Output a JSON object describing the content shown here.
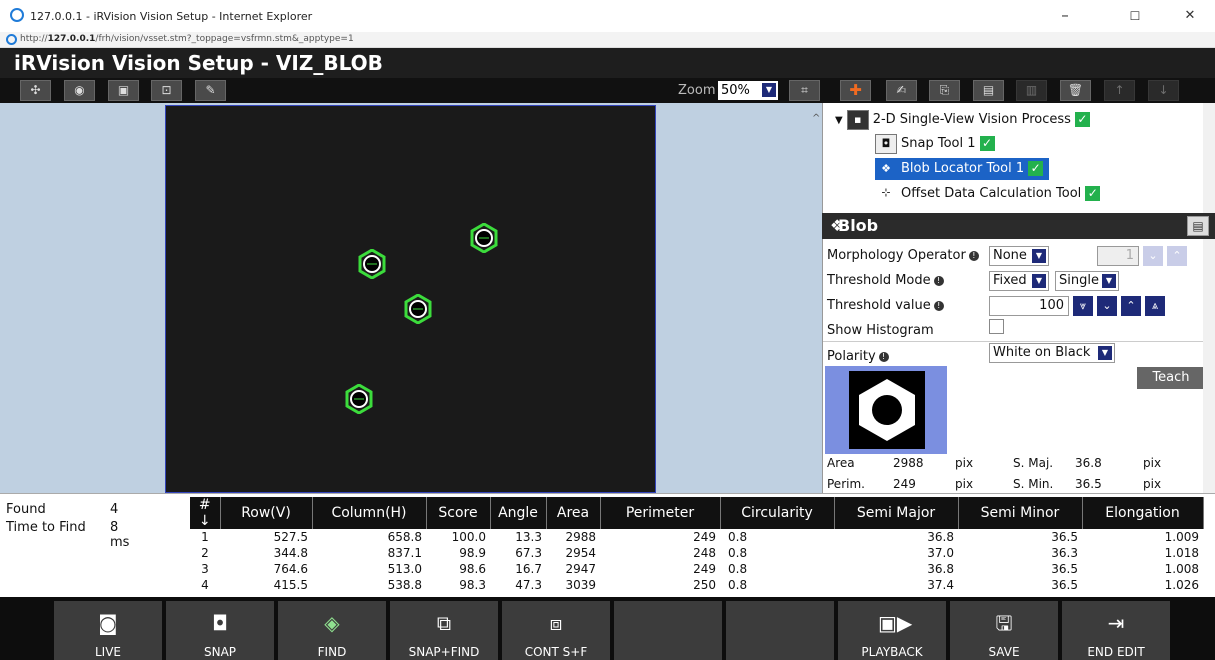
{
  "window": {
    "title": "127.0.0.1 - iRVision Vision Setup - Internet Explorer",
    "minimize": "–",
    "maximize": "☐",
    "close": "✕"
  },
  "address": {
    "prefix": "http://",
    "host": "127.0.0.1",
    "path": "/frh/vision/vsset.stm?_toppage=vsfrmn.stm&_apptype=1"
  },
  "app": {
    "title": "iRVision Vision Setup - VIZ_BLOB"
  },
  "toolbar": {
    "zoom_label": "Zoom",
    "zoom_value": "50%"
  },
  "tree": {
    "process": "2-D Single-View Vision Process",
    "items": [
      "Snap Tool 1",
      "Blob Locator Tool 1",
      "Offset Data Calculation Tool"
    ]
  },
  "panel": {
    "title": "Blob Locator Tool 1"
  },
  "props": {
    "morph_label": "Morphology Operator",
    "morph_value": "None",
    "morph_count": "1",
    "thresh_mode_label": "Threshold Mode",
    "thresh_mode_value": "Fixed",
    "thresh_mode2": "Single",
    "thresh_value_label": "Threshold value",
    "thresh_value": "100",
    "histogram_label": "Show Histogram",
    "polarity_label": "Polarity",
    "polarity_value": "White on Black",
    "teach": "Teach",
    "area_label": "Area",
    "area_value": "2988",
    "area_unit": "pix",
    "smaj_label": "S. Maj.",
    "smaj_value": "36.8",
    "smaj_unit": "pix",
    "perim_label": "Perim.",
    "perim_value": "249",
    "perim_unit": "pix",
    "smin_label": "S. Min.",
    "smin_value": "36.5",
    "smin_unit": "pix"
  },
  "summary": {
    "found_label": "Found",
    "found_value": "4",
    "time_label": "Time to Find",
    "time_value": "8 ms"
  },
  "results": {
    "headers": [
      "# ↓",
      "Row(V)",
      "Column(H)",
      "Score",
      "Angle",
      "Area",
      "Perimeter",
      "Circularity",
      "Semi Major",
      "Semi Minor",
      "Elongation"
    ],
    "rows": [
      [
        "1",
        "527.5",
        "658.8",
        "100.0",
        "13.3",
        "2988",
        "249",
        "0.8",
        "36.8",
        "36.5",
        "1.009"
      ],
      [
        "2",
        "344.8",
        "837.1",
        "98.9",
        "67.3",
        "2954",
        "248",
        "0.8",
        "37.0",
        "36.3",
        "1.018"
      ],
      [
        "3",
        "764.6",
        "513.0",
        "98.6",
        "16.7",
        "2947",
        "249",
        "0.8",
        "36.8",
        "36.5",
        "1.008"
      ],
      [
        "4",
        "415.5",
        "538.8",
        "98.3",
        "47.3",
        "3039",
        "250",
        "0.8",
        "37.4",
        "36.5",
        "1.026"
      ]
    ]
  },
  "footer": {
    "live": "LIVE",
    "snap": "SNAP",
    "find": "FIND",
    "snapfind": "SNAP+FIND",
    "cont": "CONT S+F",
    "playback": "PLAYBACK",
    "save": "SAVE",
    "endedit": "END EDIT"
  },
  "colors": {
    "accent": "#1e2a78",
    "check": "#23b14d",
    "selection": "#1c63c6",
    "add": "#f26b21"
  }
}
